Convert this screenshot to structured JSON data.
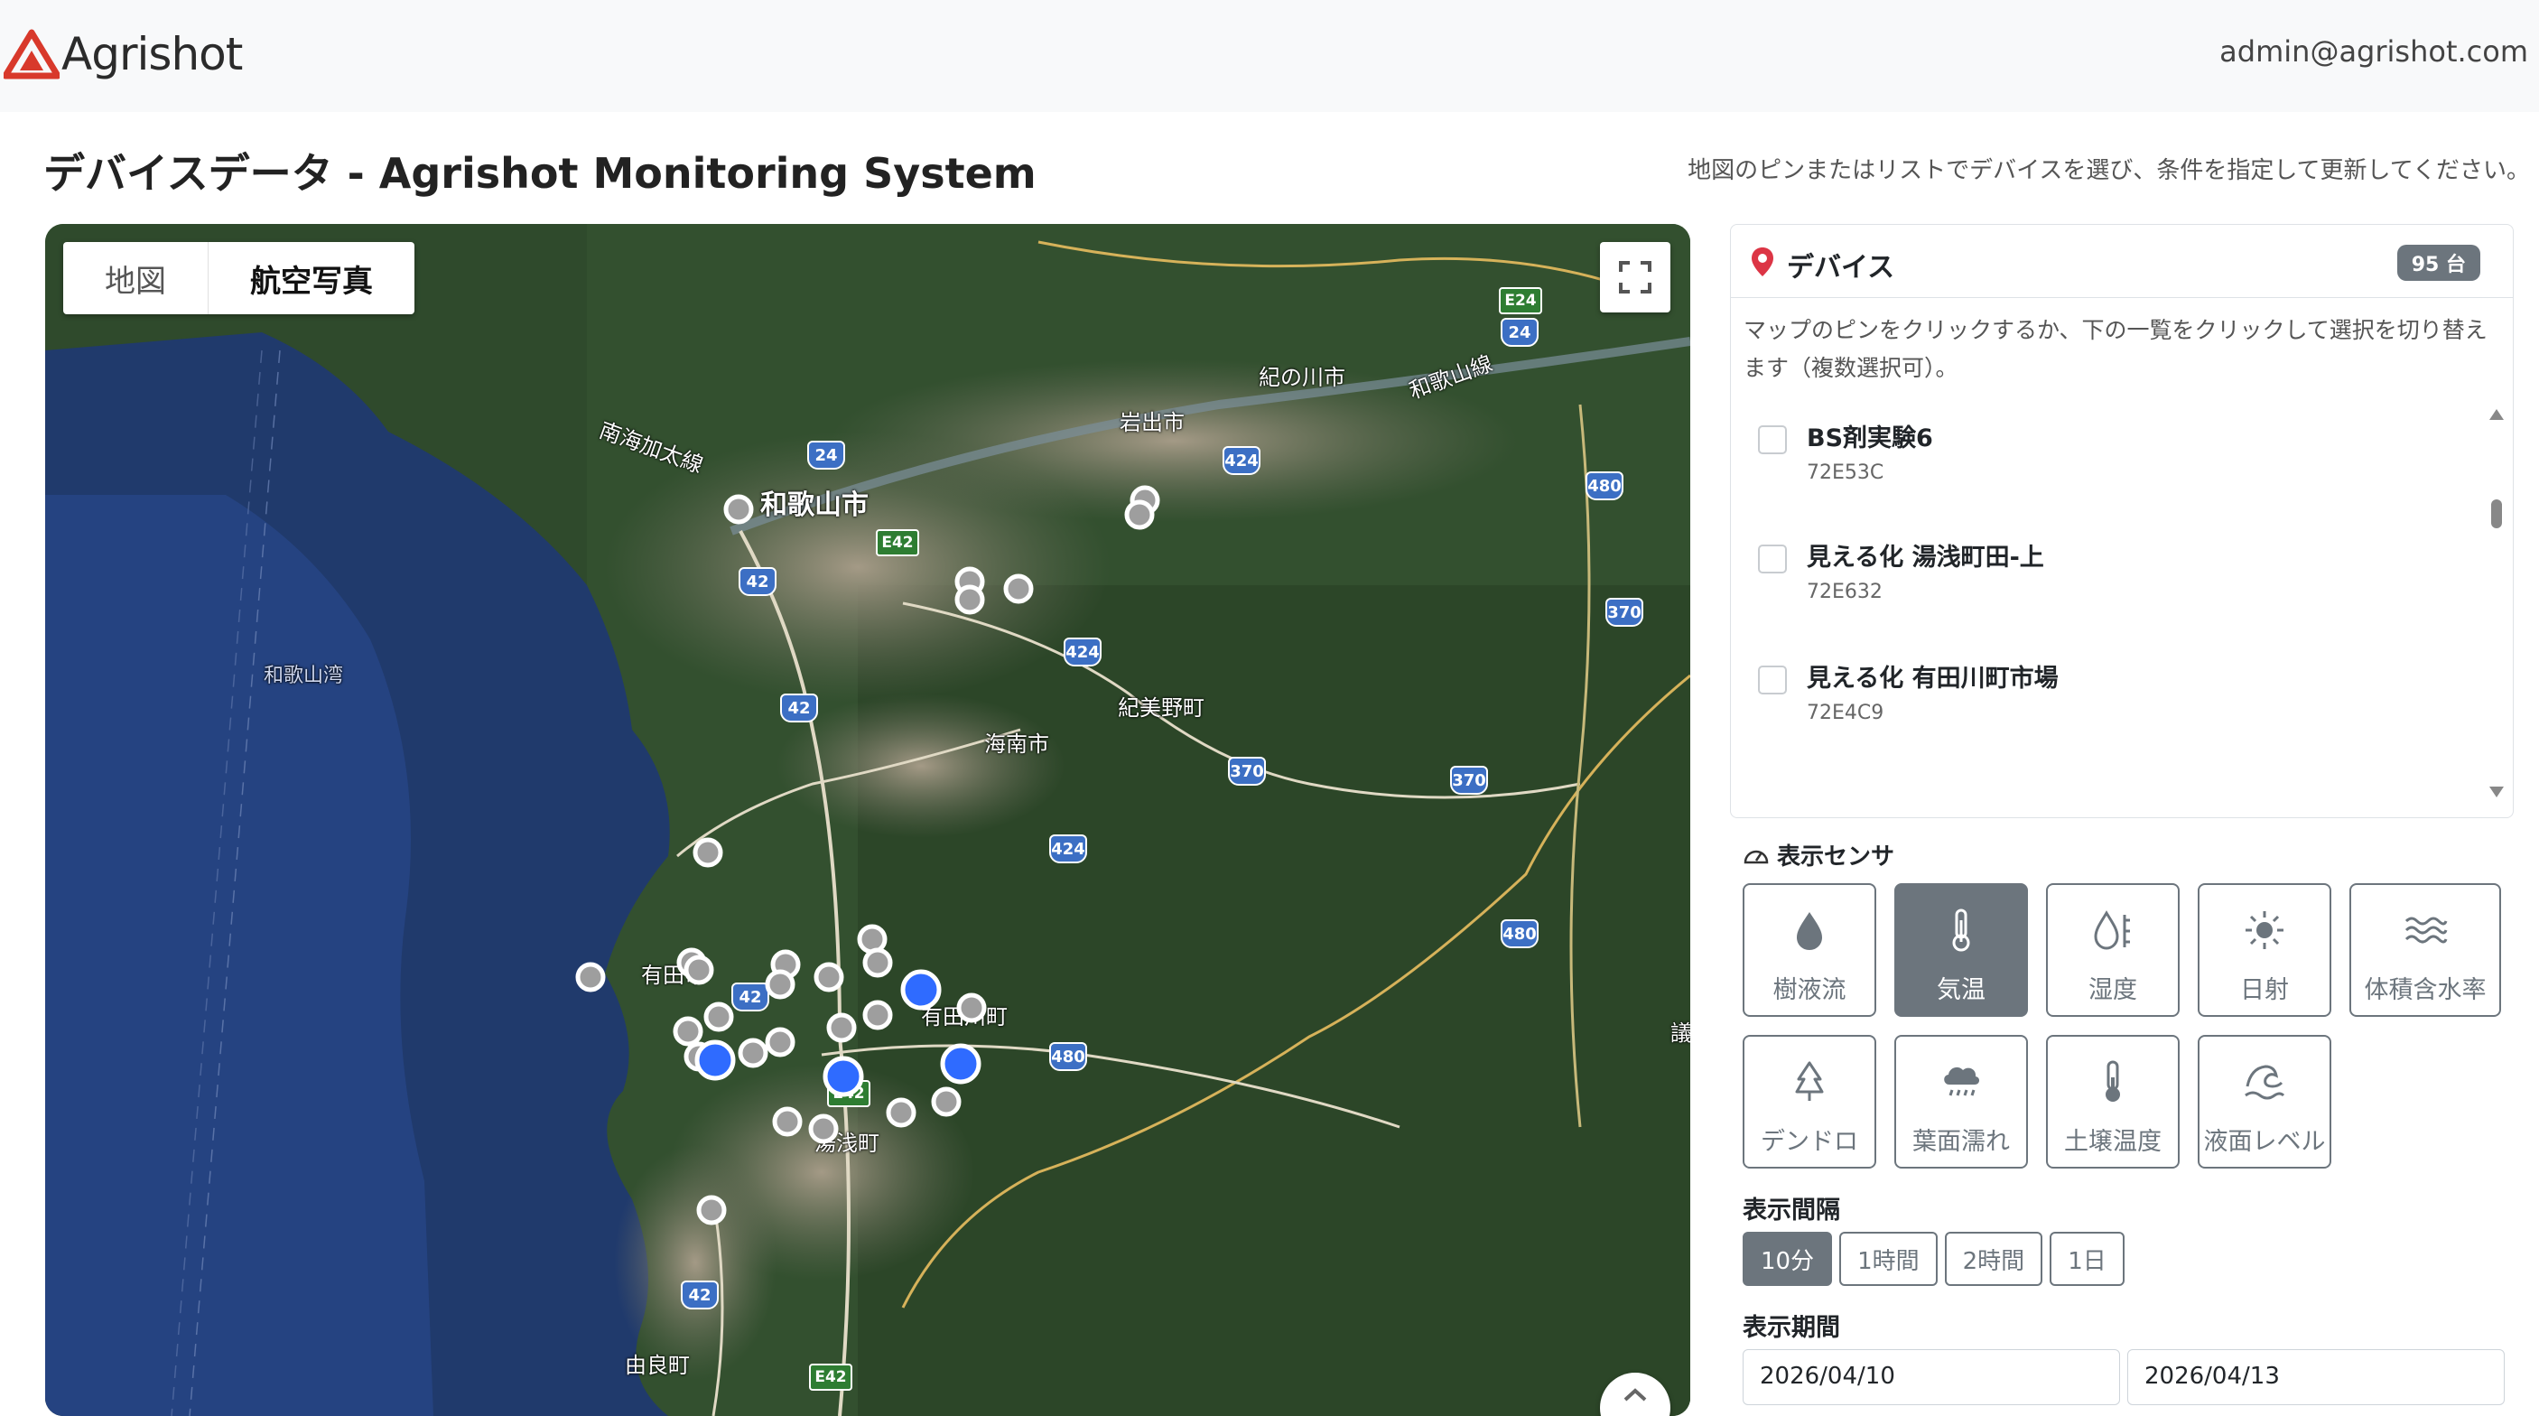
{
  "header": {
    "brand": "Agrishot",
    "user_email": "admin@agrishot.com"
  },
  "page": {
    "title": "デバイスデータ - Agrishot Monitoring System",
    "hint": "地図のピンまたはリストでデバイスを選び、条件を指定して更新してください。"
  },
  "map": {
    "type_buttons": [
      "地図",
      "航空写真"
    ],
    "active_type": "航空写真",
    "labels": {
      "wakayama": "和歌山市",
      "iwade": "岩出市",
      "kinokawa": "紀の川市",
      "kaiyama": "海南市",
      "kimino": "紀美野町",
      "arida": "有田市",
      "aridagawa": "有田川町",
      "yuasa": "湯浅町",
      "yura": "由良町",
      "bay": "和歌山湾",
      "nankai": "南海加太線",
      "wakayama_line": "和歌山線",
      "edge": "議"
    },
    "route_shields": {
      "r24a": "24",
      "r24b": "24",
      "e24": "E24",
      "r42a": "42",
      "r42b": "42",
      "r42c": "42",
      "r42d": "42",
      "e42a": "E42",
      "e42b": "E42",
      "e42c": "E42",
      "r424a": "424",
      "r424b": "424",
      "r424c": "424",
      "r370a": "370",
      "r370b": "370",
      "r370c": "370",
      "r480a": "480",
      "r480b": "480",
      "r480c": "480"
    },
    "pin_colors": {
      "unselected": "#9e9e9e",
      "selected": "#2f6bff"
    }
  },
  "devices": {
    "title": "デバイス",
    "count_badge": "95 台",
    "description": "マップのピンをクリックするか、下の一覧をクリックして選択を切り替えます（複数選択可）。",
    "items": [
      {
        "name": "BS剤実験6",
        "id": "72E53C"
      },
      {
        "name": "見える化 湯浅町田-上",
        "id": "72E632"
      },
      {
        "name": "見える化 有田川町市場",
        "id": "72E4C9"
      }
    ]
  },
  "sensors": {
    "title": "表示センサ",
    "items": [
      {
        "label": "樹液流",
        "icon": "droplet-icon"
      },
      {
        "label": "気温",
        "icon": "thermometer-icon"
      },
      {
        "label": "湿度",
        "icon": "humidity-icon"
      },
      {
        "label": "日射",
        "icon": "sun-icon"
      },
      {
        "label": "体積含水率",
        "icon": "water-waves-icon"
      },
      {
        "label": "デンドロ",
        "icon": "tree-icon"
      },
      {
        "label": "葉面濡れ",
        "icon": "cloud-rain-icon"
      },
      {
        "label": "土壌温度",
        "icon": "soil-thermometer-icon"
      },
      {
        "label": "液面レベル",
        "icon": "wave-level-icon"
      }
    ],
    "active": "気温"
  },
  "interval": {
    "title": "表示間隔",
    "options": [
      "10分",
      "1時間",
      "2時間",
      "1日"
    ],
    "active": "10分"
  },
  "period": {
    "title": "表示期間",
    "start": "2026/04/10",
    "end": "2026/04/13"
  }
}
